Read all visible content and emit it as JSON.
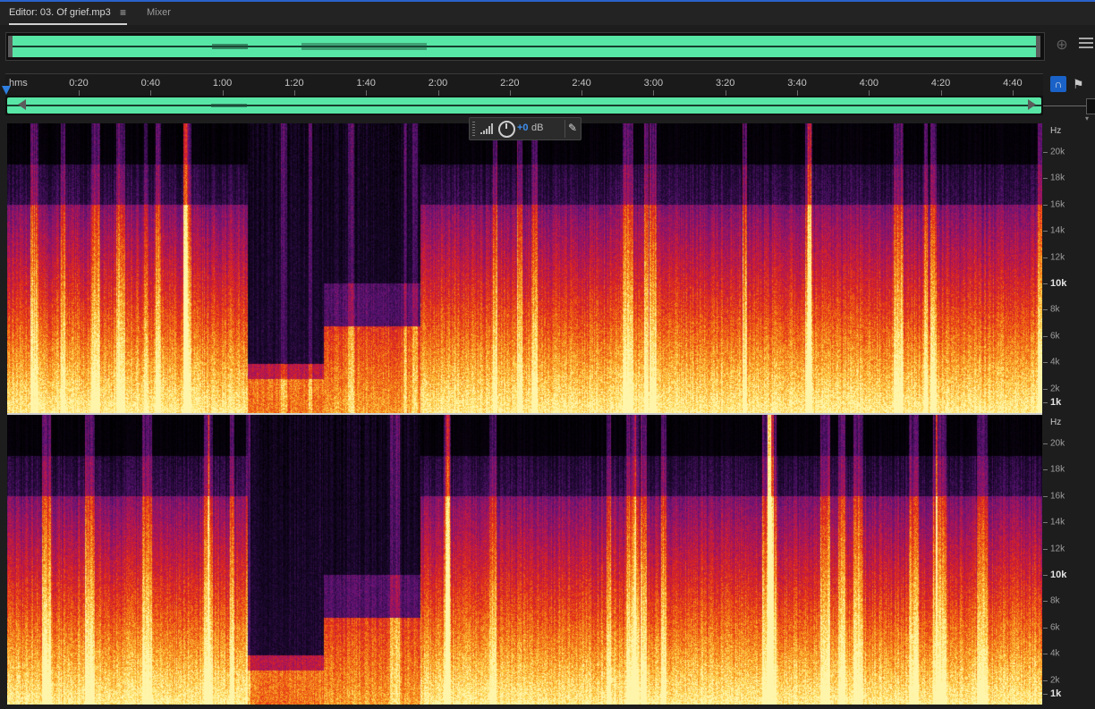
{
  "tabs": {
    "editor_label": "Editor: 03. Of grief.mp3",
    "menu_glyph": "≡",
    "mixer_label": "Mixer"
  },
  "overview": {
    "waveform_color": "#58e6a6"
  },
  "ruler": {
    "unit_label": "hms",
    "ticks": [
      "0:20",
      "0:40",
      "1:00",
      "1:20",
      "1:40",
      "2:00",
      "2:20",
      "2:40",
      "3:00",
      "3:20",
      "3:40",
      "4:00",
      "4:20",
      "4:40"
    ]
  },
  "hud": {
    "gain_value": "+0",
    "gain_unit": "dB"
  },
  "frequency_scale": {
    "unit": "Hz",
    "labels": [
      "20k",
      "18k",
      "16k",
      "14k",
      "12k",
      "10k",
      "8k",
      "6k",
      "4k",
      "2k",
      "1k"
    ],
    "major_labels": [
      "10k",
      "1k"
    ]
  },
  "colors": {
    "accent": "#2f7fe0",
    "spectrogram_low": "#000000",
    "spectrogram_mid": "#8a1fa0",
    "spectrogram_high": "#ffe066"
  },
  "icons": {
    "zoom": "zoom-target-icon",
    "panels": "panel-list-icon",
    "snap": "snap-magnet-icon",
    "marker": "marker-flag-icon",
    "pin": "pin-icon",
    "level": "level-bars-icon",
    "knob": "gain-knob-icon"
  }
}
